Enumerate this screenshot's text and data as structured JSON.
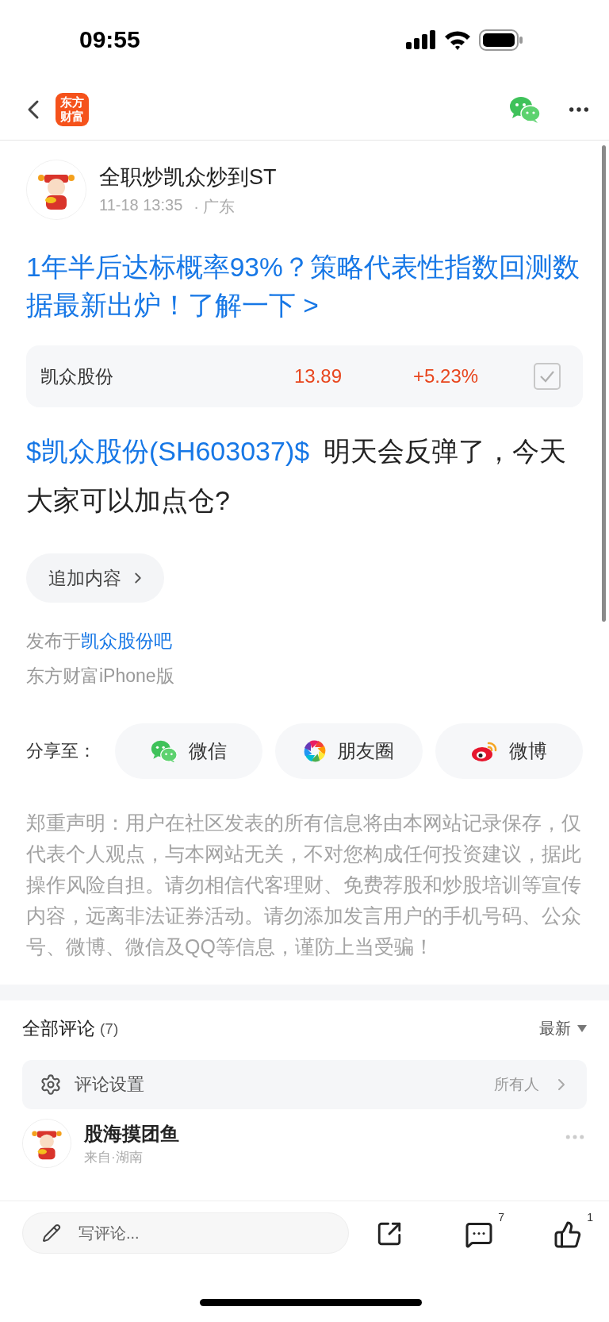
{
  "status_bar": {
    "time": "09:55"
  },
  "nav": {
    "logo": "东方财富"
  },
  "post": {
    "author": "全职炒凯众炒到ST",
    "time": "11-18 13:35",
    "location": "· 广东",
    "promo": "1年半后达标概率93%？策略代表性指数回测数据最新出炉！了解一下 >",
    "stock": {
      "name": "凯众股份",
      "price": "13.89",
      "change": "+5.23%",
      "checked": true
    },
    "stock_tag": "$凯众股份(SH603037)$",
    "body": "明天会反弹了，今天大家可以加点仓?",
    "add_button": "追加内容",
    "published_prefix": "发布于",
    "forum": "凯众股份吧",
    "client": "东方财富iPhone版"
  },
  "share": {
    "label": "分享至：",
    "targets": [
      {
        "kind": "wechat",
        "label": "微信"
      },
      {
        "kind": "moments",
        "label": "朋友圈"
      },
      {
        "kind": "weibo",
        "label": "微博"
      }
    ]
  },
  "disclaimer": "郑重声明：用户在社区发表的所有信息将由本网站记录保存，仅代表个人观点，与本网站无关，不对您构成任何投资建议，据此操作风险自担。请勿相信代客理财、免费荐股和炒股培训等宣传内容，远离非法证券活动。请勿添加发言用户的手机号码、公众号、微博、微信及QQ等信息，谨防上当受骗！",
  "comments": {
    "title": "全部评论",
    "count": "(7)",
    "sort": "最新",
    "settings_label": "评论设置",
    "settings_value": "所有人",
    "items": [
      {
        "author": "股海摸团鱼",
        "location": "来自·湖南"
      }
    ]
  },
  "bottom_bar": {
    "placeholder": "写评论...",
    "comment_count": "7",
    "like_count": "1"
  }
}
